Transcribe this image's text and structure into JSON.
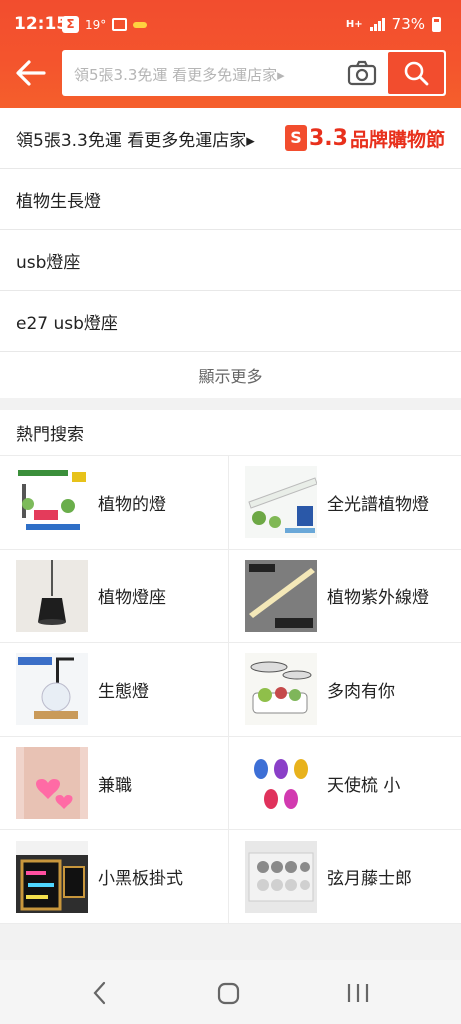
{
  "status": {
    "time": "12:15",
    "temp": "19°",
    "battery": "73%",
    "net": "H+",
    "icons": [
      "sigma-icon",
      "image-icon",
      "weather-icon",
      "signal-icon",
      "battery-icon"
    ]
  },
  "search": {
    "placeholder": "領5張3.3免運  看更多免運店家▸"
  },
  "suggestions": {
    "promo": "領5張3.3免運  看更多免運店家▸",
    "brand_num": "3.3",
    "brand_text": "品牌購物節",
    "items": [
      "植物生長燈",
      "usb燈座",
      "e27 usb燈座"
    ],
    "show_more": "顯示更多"
  },
  "hot": {
    "title": "熱門搜索",
    "items": [
      {
        "label": "植物的燈",
        "icon": "plant-lamp-thumbnail"
      },
      {
        "label": "全光譜植物燈",
        "icon": "tube-light-thumbnail"
      },
      {
        "label": "植物燈座",
        "icon": "pendant-lamp-thumbnail"
      },
      {
        "label": "植物紫外線燈",
        "icon": "led-bar-thumbnail"
      },
      {
        "label": "生態燈",
        "icon": "eco-lamp-thumbnail"
      },
      {
        "label": "多肉有你",
        "icon": "succulent-light-thumbnail"
      },
      {
        "label": "兼職",
        "icon": "part-time-thumbnail"
      },
      {
        "label": "天使梳 小",
        "icon": "angel-comb-thumbnail"
      },
      {
        "label": "小黑板掛式",
        "icon": "blackboard-thumbnail"
      },
      {
        "label": "弦月藤士郎",
        "icon": "figure-thumbnail"
      }
    ]
  },
  "colors": {
    "brand": "#f24d2e",
    "accent": "#e8301c"
  }
}
